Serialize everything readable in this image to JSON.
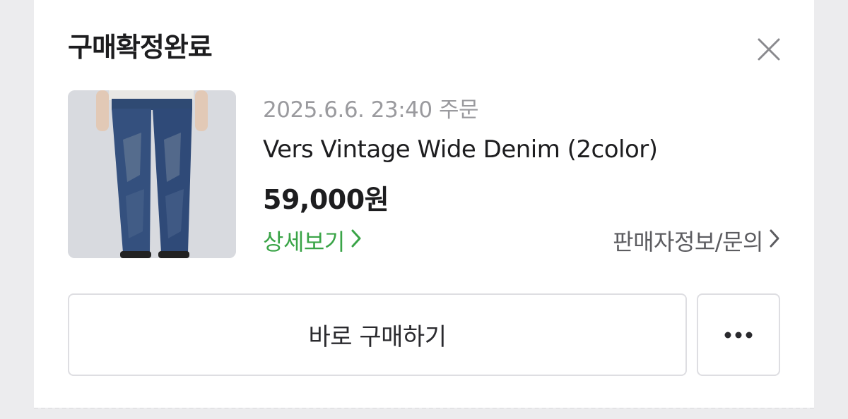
{
  "dialog": {
    "title": "구매확정완료",
    "close_icon": "close-icon"
  },
  "order": {
    "date": "2025.6.6. 23:40 주문",
    "product_name": "Vers Vintage Wide Denim (2color)",
    "price": "59,000원",
    "thumbnail_icon": "product-thumbnail",
    "detail_link": "상세보기",
    "seller_link": "판매자정보/문의"
  },
  "actions": {
    "buy_again": "바로 구매하기",
    "more_icon": "more-dots-icon"
  },
  "colors": {
    "accent_green": "#3aa447",
    "text_primary": "#1d1d1f",
    "text_secondary": "#9a9a9e",
    "border": "#dedee2"
  }
}
